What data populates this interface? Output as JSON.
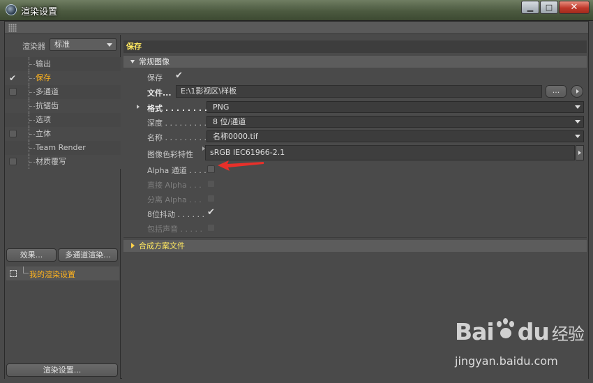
{
  "window": {
    "title": "渲染设置",
    "buttons": {
      "minimize": "▁",
      "maximize": "□",
      "close": "✕"
    }
  },
  "left": {
    "renderer_label": "渲染器",
    "renderer_value": "标准",
    "items": [
      {
        "label": "输出",
        "checkbox": false,
        "checked": false,
        "active": false
      },
      {
        "label": "保存",
        "checkbox": true,
        "checked": true,
        "active": true
      },
      {
        "label": "多通道",
        "checkbox": true,
        "checked": false,
        "active": false
      },
      {
        "label": "抗锯齿",
        "checkbox": false,
        "checked": false,
        "active": false
      },
      {
        "label": "选项",
        "checkbox": false,
        "checked": false,
        "active": false
      },
      {
        "label": "立体",
        "checkbox": true,
        "checked": false,
        "active": false
      },
      {
        "label": "Team Render",
        "checkbox": false,
        "checked": false,
        "active": false
      },
      {
        "label": "材质覆写",
        "checkbox": true,
        "checked": false,
        "active": false
      }
    ],
    "effects_button": "效果...",
    "multipass_button": "多通道渲染...",
    "my_settings": "我的渲染设置",
    "render_settings_button": "渲染设置..."
  },
  "right": {
    "section_title": "保存",
    "general_group": "常规图像",
    "save_label": "保存",
    "save_checked": true,
    "file_label": "文件...",
    "file_value": "E:\\1影视区\\样板",
    "browse_label": "...",
    "format_label": "格式 . . . . . . . . .",
    "format_value": "PNG",
    "depth_label": "深度 . . . . . . . . .",
    "depth_value": "8 位/通道",
    "name_label": "名称 . . . . . . . . .",
    "name_value": "名称0000.tif",
    "color_profile_label": "图像色彩特性",
    "color_profile_value": "sRGB IEC61966-2.1",
    "alpha_label": "Alpha 通道 . . . .",
    "straight_alpha_label": "直接 Alpha . . .",
    "separate_alpha_label": "分离 Alpha . . .",
    "dither_label": "8位抖动 . . . . . .",
    "dither_checked": true,
    "include_sound_label": "包括声音 . . . . .",
    "compositing_group": "合成方案文件"
  },
  "watermark": {
    "logo_left": "Bai",
    "logo_right": "du",
    "logo_cn": "经验",
    "url": "jingyan.baidu.com"
  },
  "colors": {
    "accent_orange": "#ffb31e",
    "section_yellow": "#ffe860",
    "arrow_red": "#e8302a"
  }
}
